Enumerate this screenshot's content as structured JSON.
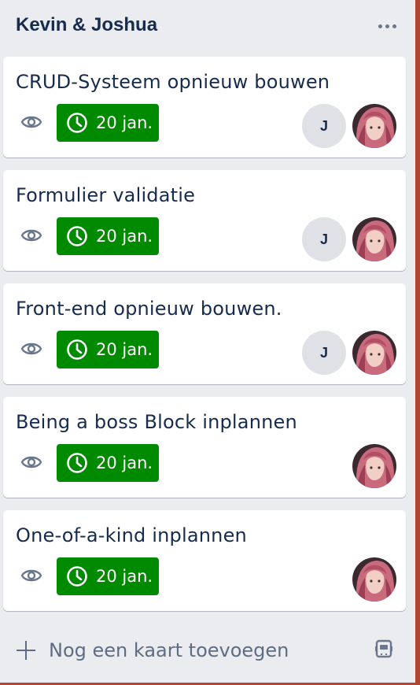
{
  "list": {
    "title": "Kevin & Joshua",
    "menu_icon": "more-horizontal-icon"
  },
  "cards": [
    {
      "title": "CRUD-Systeem opnieuw bouwen",
      "due": "20 jan.",
      "members": [
        "J",
        "avatar"
      ]
    },
    {
      "title": "Formulier validatie",
      "due": "20 jan.",
      "members": [
        "J",
        "avatar"
      ]
    },
    {
      "title": "Front-end opnieuw bouwen.",
      "due": "20 jan.",
      "members": [
        "J",
        "avatar"
      ]
    },
    {
      "title": "Being a boss Block inplannen",
      "due": "20 jan.",
      "members": [
        "avatar"
      ]
    },
    {
      "title": "One-of-a-kind inplannen",
      "due": "20 jan.",
      "members": [
        "avatar"
      ]
    }
  ],
  "footer": {
    "add_card_label": "Nog een kaart toevoegen",
    "add_icon": "plus-icon",
    "template_icon": "card-template-icon"
  },
  "colors": {
    "due_badge": "#008a00",
    "list_background": "#ebecf0",
    "board_edge": "#b04632"
  }
}
